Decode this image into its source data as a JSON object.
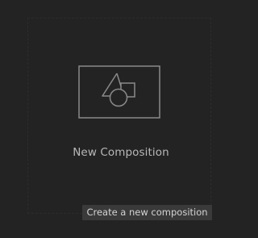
{
  "new_composition": {
    "label": "New Composition",
    "icon": "composition-shapes-icon"
  },
  "tooltip": {
    "text": "Create a new composition"
  },
  "colors": {
    "background": "#232323",
    "icon_stroke": "#8a8a8a",
    "label_text": "#b8b8b8",
    "tooltip_bg": "#3a3a3a",
    "tooltip_text": "#d4d4d4"
  }
}
